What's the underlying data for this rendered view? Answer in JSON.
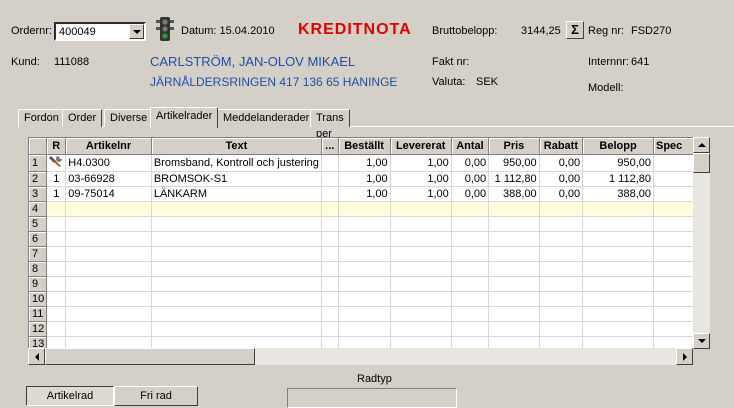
{
  "header": {
    "ordernr_label": "Ordernr:",
    "ordernr_value": "400049",
    "datum": "Datum: 15.04.2010",
    "doc_type": "KREDITNOTA",
    "brutto_label": "Bruttobelopp:",
    "brutto_value": "3144,25",
    "sum_symbol": "Σ",
    "regnr_label": "Reg nr:",
    "regnr_value": "FSD270",
    "kund_label": "Kund:",
    "kund_value": "111088",
    "customer_name": "CARLSTRÖM, JAN-OLOV MIKAEL",
    "customer_address": "JÄRNÅLDERSRINGEN 417 136 65 HANINGE",
    "fakt_label": "Fakt nr:",
    "internnr_label": "Internnr:",
    "internnr_value": "641",
    "valuta_label": "Valuta:",
    "valuta_value": "SEK",
    "modell_label": "Modell:",
    "status_color_active": "#2e9a2e"
  },
  "tabs": [
    {
      "label": "Fordon"
    },
    {
      "label": "Order"
    },
    {
      "label": "Diverse"
    },
    {
      "label": "Artikelrader",
      "active": true
    },
    {
      "label": "Meddelanderader"
    },
    {
      "label": "Trans per order"
    }
  ],
  "grid": {
    "columns": [
      "R",
      "Artikelnr",
      "Text",
      "...",
      "Beställt",
      "Levererat",
      "Antal",
      "Pris",
      "Rabatt",
      "Belopp",
      "Spec"
    ],
    "rows": [
      {
        "n": "1",
        "r": "",
        "artikelnr": "H4.0300",
        "text": "Bromsband, Kontroll och justering",
        "bestallt": "1,00",
        "levererat": "1,00",
        "antal": "0,00",
        "pris": "950,00",
        "rabatt": "0,00",
        "belopp": "950,00",
        "spec": ""
      },
      {
        "n": "2",
        "r": "1",
        "artikelnr": "03-66928",
        "text": "BROMSOK-S1",
        "bestallt": "1,00",
        "levererat": "1,00",
        "antal": "0,00",
        "pris": "1 112,80",
        "rabatt": "0,00",
        "belopp": "1 112,80",
        "spec": ""
      },
      {
        "n": "3",
        "r": "1",
        "artikelnr": "09-75014",
        "text": "LÄNKARM",
        "bestallt": "1,00",
        "levererat": "1,00",
        "antal": "0,00",
        "pris": "388,00",
        "rabatt": "0,00",
        "belopp": "388,00",
        "spec": ""
      },
      {
        "n": "4"
      },
      {
        "n": "5"
      },
      {
        "n": "6"
      },
      {
        "n": "7"
      },
      {
        "n": "8"
      },
      {
        "n": "9"
      },
      {
        "n": "10"
      },
      {
        "n": "11"
      },
      {
        "n": "12"
      },
      {
        "n": "13"
      }
    ]
  },
  "bottom": {
    "radtyp_label": "Radtyp",
    "artikelrad": "Artikelrad",
    "fri_rad": "Fri rad"
  }
}
